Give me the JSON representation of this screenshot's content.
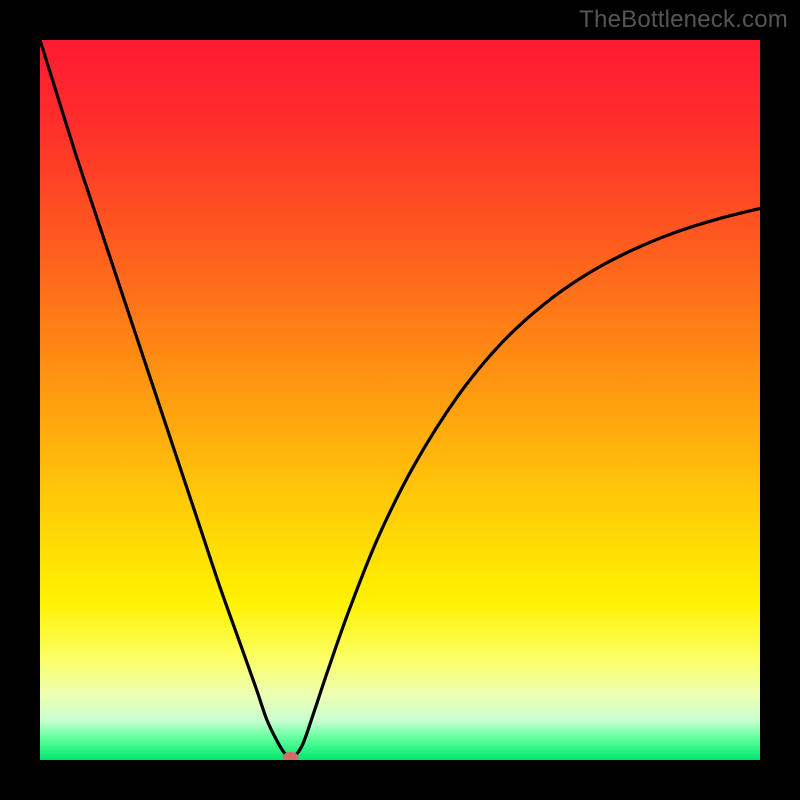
{
  "watermark": {
    "text": "TheBottleneck.com"
  },
  "chart_data": {
    "type": "line",
    "title": "",
    "xlabel": "",
    "ylabel": "",
    "xlim": [
      0,
      100
    ],
    "ylim": [
      0,
      100
    ],
    "grid": false,
    "legend": false,
    "background_gradient": {
      "stops": [
        {
          "pos": 0.0,
          "color": "#ff1a33"
        },
        {
          "pos": 0.12,
          "color": "#ff2f2b"
        },
        {
          "pos": 0.28,
          "color": "#ff5b1f"
        },
        {
          "pos": 0.45,
          "color": "#ff8e12"
        },
        {
          "pos": 0.62,
          "color": "#ffc409"
        },
        {
          "pos": 0.78,
          "color": "#fff200"
        },
        {
          "pos": 0.86,
          "color": "#fcff66"
        },
        {
          "pos": 0.91,
          "color": "#edffb3"
        },
        {
          "pos": 0.945,
          "color": "#c8ffd0"
        },
        {
          "pos": 0.97,
          "color": "#5fff9c"
        },
        {
          "pos": 1.0,
          "color": "#00e66a"
        }
      ]
    },
    "series": [
      {
        "name": "curve",
        "color": "#000000",
        "x": [
          0,
          2.5,
          5,
          7.5,
          10,
          12.5,
          15,
          17.5,
          20,
          22.5,
          25,
          27.5,
          30,
          31.5,
          33,
          34,
          34.8,
          35.3,
          36.5,
          38,
          40,
          43,
          47,
          52,
          58,
          64,
          70,
          76,
          82,
          88,
          94,
          100
        ],
        "y": [
          100,
          92,
          84,
          76.5,
          69,
          61.5,
          54,
          46.5,
          39,
          31.5,
          24,
          17,
          10,
          5.6,
          2.5,
          0.9,
          0.15,
          0.4,
          2.2,
          6.5,
          12.5,
          21,
          31,
          41,
          50.5,
          57.8,
          63.3,
          67.5,
          70.7,
          73.2,
          75.1,
          76.6
        ]
      }
    ],
    "markers": [
      {
        "name": "min-marker",
        "x": 34.8,
        "y": 0,
        "color": "#d46a6a",
        "rx": 8,
        "ry": 5
      }
    ]
  }
}
